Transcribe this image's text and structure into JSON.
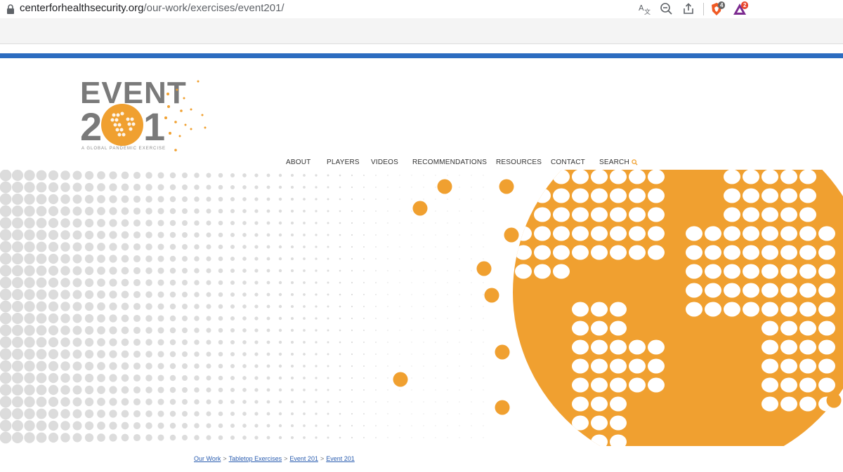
{
  "browser": {
    "url_domain": "centerforhealthsecurity.org",
    "url_path": "/our-work/exercises/event201/",
    "extensions": [
      {
        "name": "brave-shield-icon",
        "badge": "4"
      },
      {
        "name": "brave-rewards-icon",
        "badge": "2"
      }
    ]
  },
  "logo": {
    "title": "EVENT 201",
    "subtitle": "A GLOBAL PANDEMIC EXERCISE"
  },
  "nav": {
    "about": "ABOUT",
    "players": "PLAYERS",
    "videos": "VIDEOS",
    "recommendations": "RECOMMENDATIONS",
    "resources": "RESOURCES",
    "contact": "CONTACT",
    "search": "SEARCH"
  },
  "breadcrumb": {
    "our_work": "Our Work",
    "tabletop": "Tabletop Exercises",
    "event1": "Event 201",
    "event2": "Event 201",
    "separator": ">"
  },
  "colors": {
    "accent_blue": "#2c6cc0",
    "brand_orange": "#f0a030",
    "logo_gray": "#7a7a7a",
    "dot_gray": "#dcdcdc"
  }
}
